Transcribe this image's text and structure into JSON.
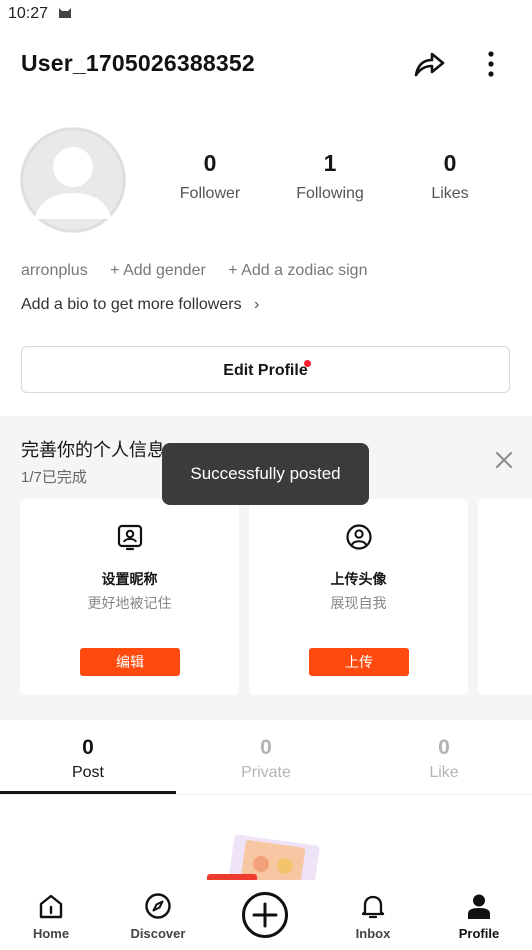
{
  "status_bar": {
    "time": "10:27"
  },
  "header": {
    "username": "User_1705026388352"
  },
  "stats": [
    {
      "value": "0",
      "label": "Follower"
    },
    {
      "value": "1",
      "label": "Following"
    },
    {
      "value": "0",
      "label": "Likes"
    }
  ],
  "profile": {
    "handle": "arronplus",
    "add_gender": "+ Add gender",
    "add_zodiac": "+ Add a zodiac sign",
    "bio_prompt": "Add a bio to get more followers",
    "edit_profile_label": "Edit Profile"
  },
  "completion": {
    "title": "完善你的个人信息",
    "progress": "1/7已完成",
    "cards": [
      {
        "title": "设置昵称",
        "subtitle": "更好地被记住",
        "button": "编辑"
      },
      {
        "title": "上传头像",
        "subtitle": "展现自我",
        "button": "上传"
      }
    ]
  },
  "toast": {
    "message": "Successfully posted"
  },
  "tabs": [
    {
      "count": "0",
      "label": "Post"
    },
    {
      "count": "0",
      "label": "Private"
    },
    {
      "count": "0",
      "label": "Like"
    }
  ],
  "bottom_nav": {
    "items": [
      {
        "label": "Home",
        "icon": "home-icon"
      },
      {
        "label": "Discover",
        "icon": "compass-icon"
      },
      {
        "label": "",
        "icon": "plus-icon"
      },
      {
        "label": "Inbox",
        "icon": "bell-icon"
      },
      {
        "label": "Profile",
        "icon": "person-icon"
      }
    ]
  },
  "colors": {
    "accent": "#fe4a0e",
    "notification_dot": "#ff1f2c",
    "toast_bg": "#3b3b3b",
    "section_bg": "#f5f5f5"
  }
}
